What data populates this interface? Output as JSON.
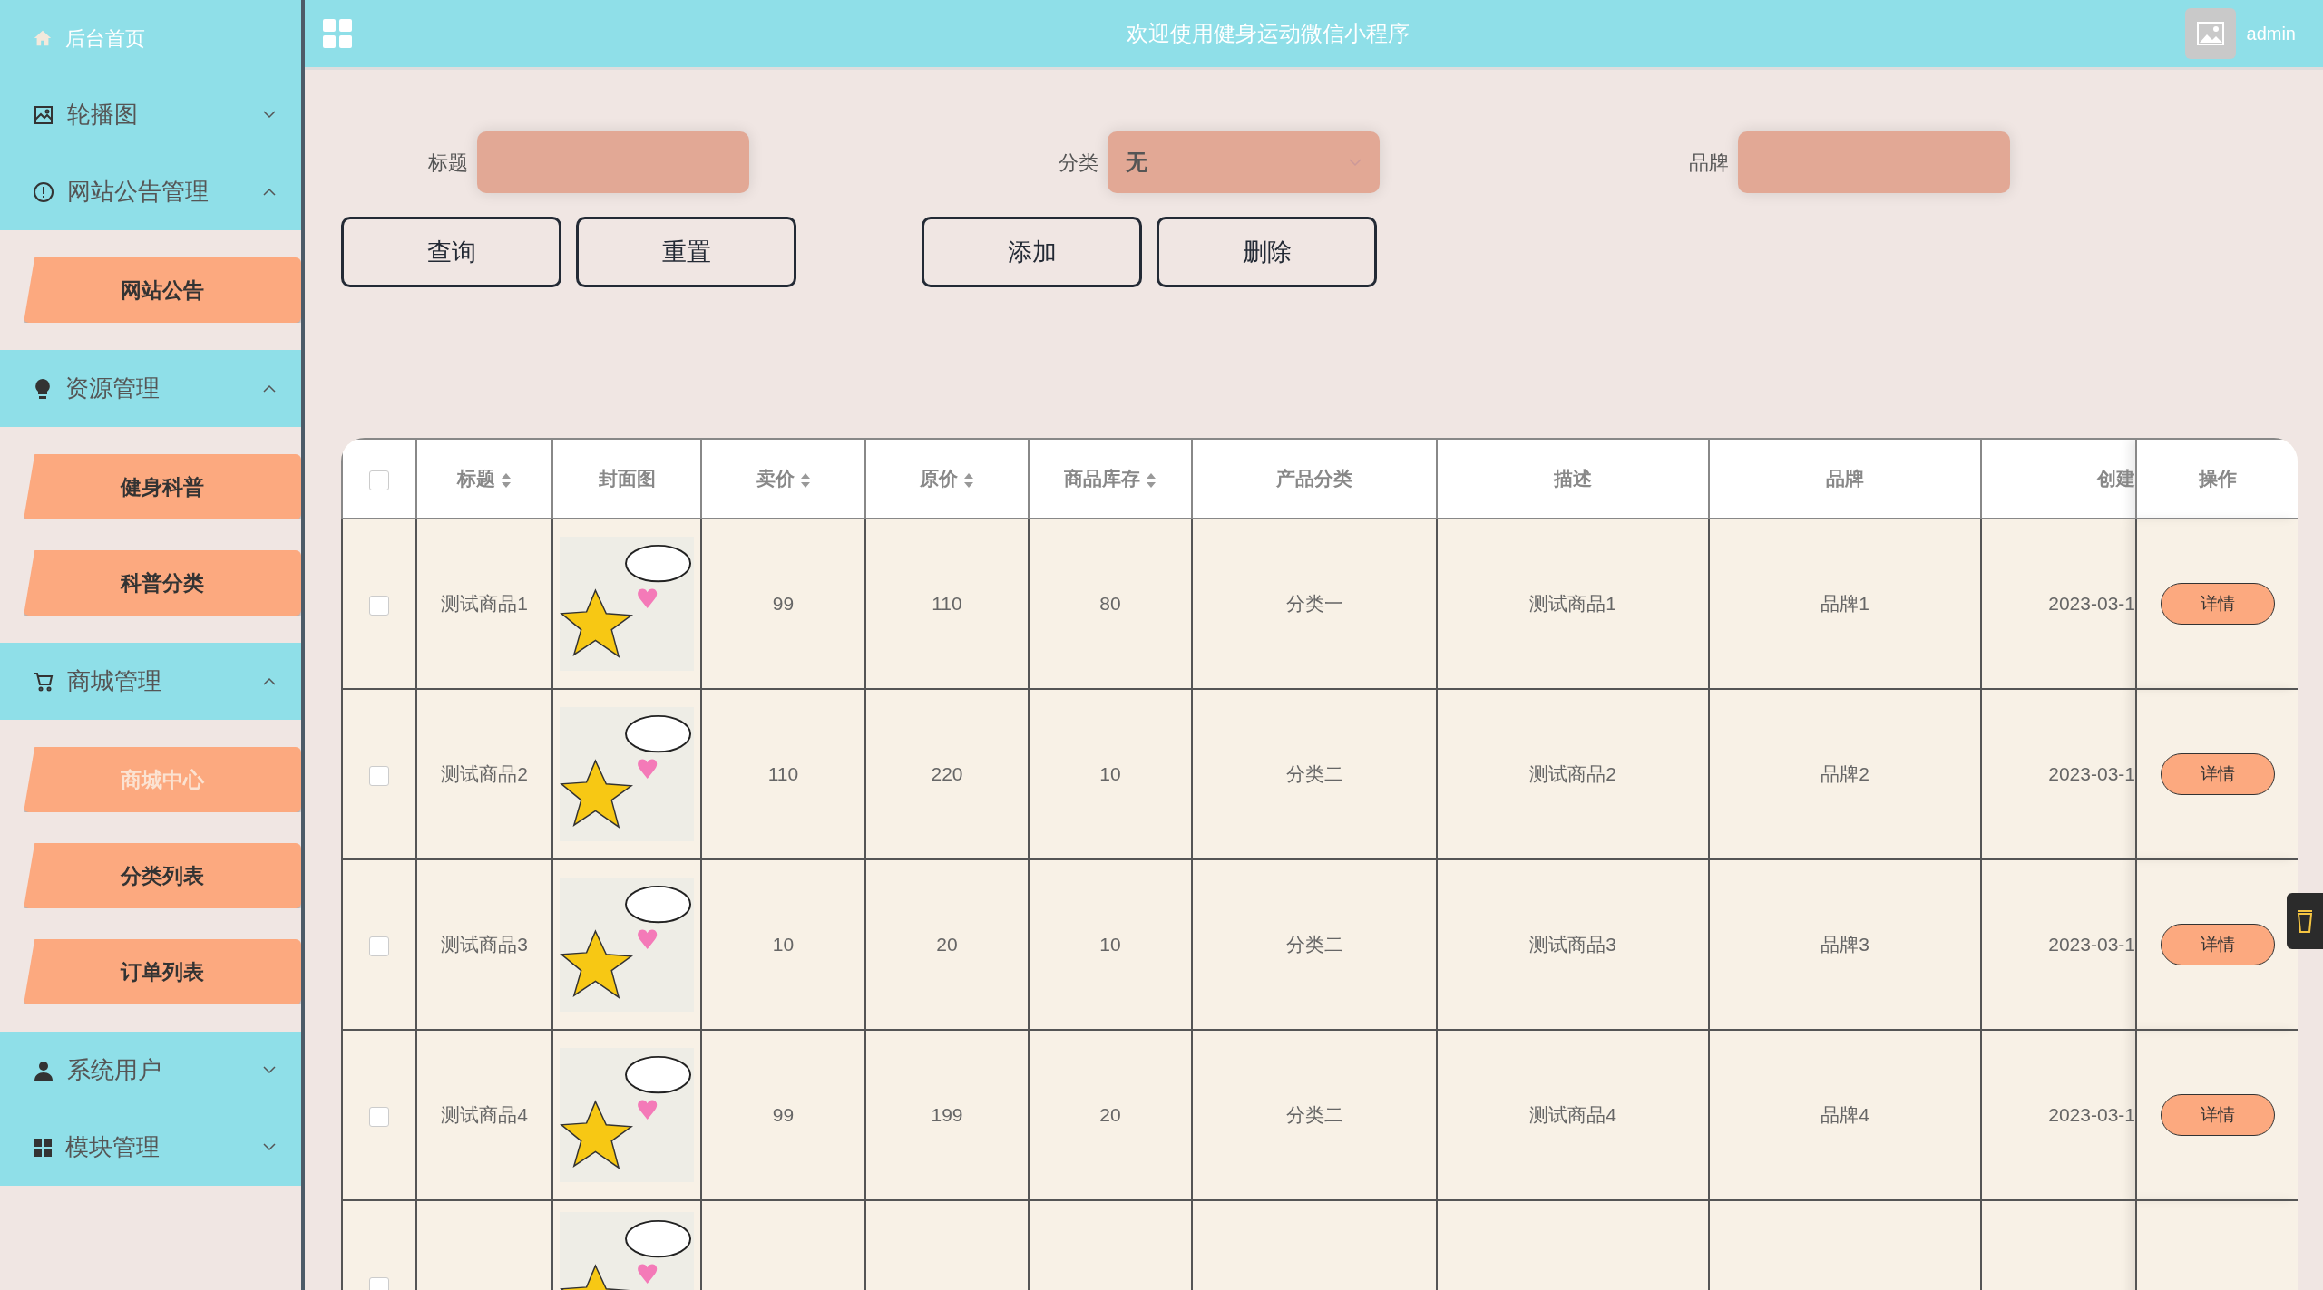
{
  "header": {
    "title": "欢迎使用健身运动微信小程序",
    "user": "admin"
  },
  "sidebar": {
    "items": [
      {
        "label": "后台首页",
        "kind": "link"
      },
      {
        "label": "轮播图",
        "kind": "group",
        "expanded": false
      },
      {
        "label": "网站公告管理",
        "kind": "group",
        "expanded": true,
        "children": [
          {
            "label": "网站公告",
            "selected": false
          }
        ]
      },
      {
        "label": "资源管理",
        "kind": "group",
        "expanded": true,
        "children": [
          {
            "label": "健身科普",
            "selected": false
          },
          {
            "label": "科普分类",
            "selected": false
          }
        ]
      },
      {
        "label": "商城管理",
        "kind": "group",
        "expanded": true,
        "children": [
          {
            "label": "商城中心",
            "selected": true
          },
          {
            "label": "分类列表",
            "selected": false
          },
          {
            "label": "订单列表",
            "selected": false
          }
        ]
      },
      {
        "label": "系统用户",
        "kind": "group",
        "expanded": false
      },
      {
        "label": "模块管理",
        "kind": "group",
        "expanded": false
      }
    ]
  },
  "search": {
    "fields": [
      {
        "label": "标题",
        "kind": "input"
      },
      {
        "label": "分类",
        "kind": "select",
        "value": "无"
      },
      {
        "label": "品牌",
        "kind": "input"
      }
    ],
    "buttons": [
      "查询",
      "重置",
      "添加",
      "删除"
    ]
  },
  "table": {
    "header_checked": false,
    "columns": [
      {
        "label": "标题",
        "sortable": true
      },
      {
        "label": "封面图",
        "sortable": false
      },
      {
        "label": "卖价",
        "sortable": true
      },
      {
        "label": "原价",
        "sortable": true
      },
      {
        "label": "商品库存",
        "sortable": true
      },
      {
        "label": "产品分类",
        "sortable": false
      },
      {
        "label": "描述",
        "sortable": false
      },
      {
        "label": "品牌",
        "sortable": false
      },
      {
        "label": "创建",
        "sortable": false
      },
      {
        "label": "操作",
        "sortable": false
      }
    ],
    "rows": [
      {
        "checked": false,
        "cells": [
          "测试商品1",
          "",
          "99",
          "110",
          "80",
          "分类一",
          "测试商品1",
          "品牌1",
          "2023-03-1"
        ],
        "action": "详情"
      },
      {
        "checked": false,
        "cells": [
          "测试商品2",
          "",
          "110",
          "220",
          "10",
          "分类二",
          "测试商品2",
          "品牌2",
          "2023-03-1"
        ],
        "action": "详情"
      },
      {
        "checked": false,
        "cells": [
          "测试商品3",
          "",
          "10",
          "20",
          "10",
          "分类二",
          "测试商品3",
          "品牌3",
          "2023-03-1"
        ],
        "action": "详情"
      },
      {
        "checked": false,
        "cells": [
          "测试商品4",
          "",
          "99",
          "199",
          "20",
          "分类二",
          "测试商品4",
          "品牌4",
          "2023-03-1"
        ],
        "action": "详情"
      },
      {
        "checked": false
      }
    ]
  }
}
